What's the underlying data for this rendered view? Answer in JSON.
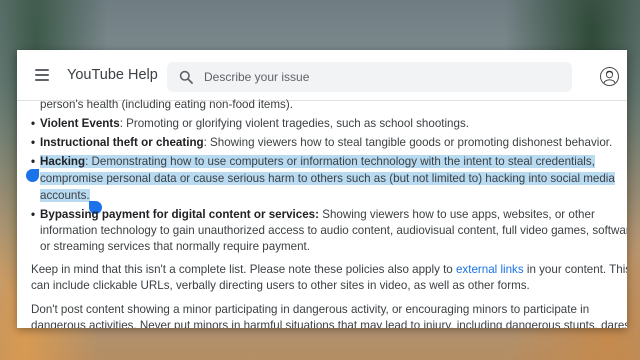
{
  "header": {
    "app_title": "YouTube Help",
    "search_placeholder": "Describe your issue"
  },
  "content": {
    "top_fragment": "person's health (including eating non-food items).",
    "bullets": [
      {
        "bold": "Violent Events",
        "text": ": Promoting or glorifying violent tragedies, such as school shootings."
      },
      {
        "bold": "Instructional theft or cheating",
        "text": ": Showing viewers how to steal tangible goods or promoting dishonest behavior."
      },
      {
        "bold": "Hacking",
        "line1": ": Demonstrating how to use computers or information technology with the intent to steal credentials,",
        "line2": "compromise personal data or cause serious harm to others such as (but not limited to) hacking into social media",
        "line3": "accounts."
      },
      {
        "bold_part1": "Bypassing",
        "bold_part2": "payment for digital content or services:",
        "line1": " Showing viewers how to use apps, websites, or other",
        "line2": "information technology to gain unauthorized access to audio content, audiovisual content, full video games, software,",
        "line3": "or streaming services that normally require payment."
      }
    ],
    "paragraph1": {
      "line1_before": "Keep in mind that this isn't a complete list. Please note these policies also apply to ",
      "link": "external links",
      "line1_after": " in your content. This",
      "line2": "can include clickable URLs, verbally directing users to other sites in video, as well as other forms."
    },
    "paragraph2": {
      "line1": "Don't post content showing a minor participating in dangerous activity, or encouraging minors to participate in",
      "line2": "dangerous activities. Never put minors in harmful situations that may lead to injury, including dangerous stunts, dares,"
    }
  },
  "colors": {
    "highlight": "#b9dbf2",
    "link": "#1a73e8",
    "selection_handle": "#1a73e8"
  },
  "icons": [
    "menu-icon",
    "search-icon",
    "avatar"
  ]
}
